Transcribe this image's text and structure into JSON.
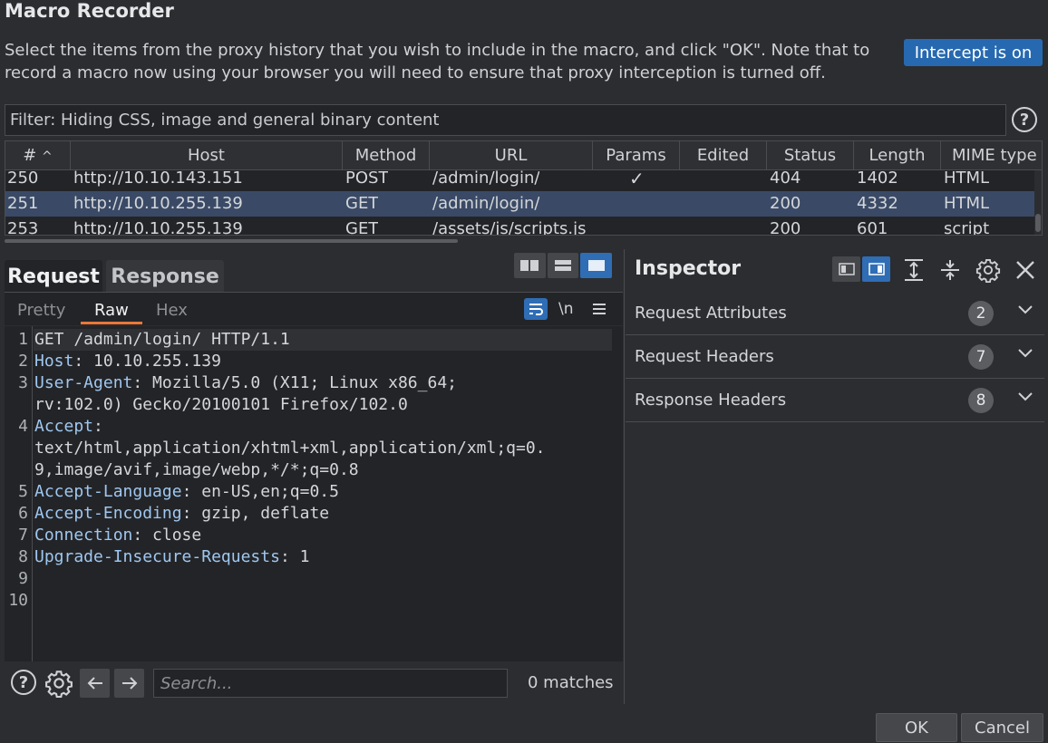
{
  "window": {
    "title": "Macro Recorder"
  },
  "description": "Select the items from the proxy history that you wish to include in the macro, and click \"OK\". Note that to record a macro now using your browser you will need to ensure that proxy interception is turned off.",
  "intercept_button": "Intercept is on",
  "filter": {
    "text": "Filter: Hiding CSS, image and general binary content"
  },
  "table": {
    "columns": [
      "#",
      "Host",
      "Method",
      "URL",
      "Params",
      "Edited",
      "Status",
      "Length",
      "MIME type"
    ],
    "sort_indicator": "^",
    "rows": [
      {
        "num": "250",
        "host": "http://10.10.143.151",
        "method": "POST",
        "url": "/admin/login/",
        "params": "✓",
        "edited": "",
        "status": "404",
        "length": "1402",
        "mime": "HTML"
      },
      {
        "num": "251",
        "host": "http://10.10.255.139",
        "method": "GET",
        "url": "/admin/login/",
        "params": "",
        "edited": "",
        "status": "200",
        "length": "4332",
        "mime": "HTML"
      },
      {
        "num": "253",
        "host": "http://10.10.255.139",
        "method": "GET",
        "url": "/assets/js/scripts.js",
        "params": "",
        "edited": "",
        "status": "200",
        "length": "601",
        "mime": "script"
      }
    ],
    "selected_row": "251"
  },
  "tabs": {
    "request": "Request",
    "response": "Response"
  },
  "subtabs": {
    "pretty": "Pretty",
    "raw": "Raw",
    "hex": "Hex",
    "newline": "\\n"
  },
  "editor": {
    "lines": [
      {
        "n": "1",
        "name": "",
        "value": "GET /admin/login/ HTTP/1.1"
      },
      {
        "n": "2",
        "name": "Host",
        "value": ": 10.10.255.139"
      },
      {
        "n": "3",
        "name": "User-Agent",
        "value": ": Mozilla/5.0 (X11; Linux x86_64;"
      },
      {
        "n": "",
        "name": "",
        "value": "rv:102.0) Gecko/20100101 Firefox/102.0"
      },
      {
        "n": "4",
        "name": "Accept",
        "value": ":"
      },
      {
        "n": "",
        "name": "",
        "value": "text/html,application/xhtml+xml,application/xml;q=0."
      },
      {
        "n": "",
        "name": "",
        "value": "9,image/avif,image/webp,*/*;q=0.8"
      },
      {
        "n": "5",
        "name": "Accept-Language",
        "value": ": en-US,en;q=0.5"
      },
      {
        "n": "6",
        "name": "Accept-Encoding",
        "value": ": gzip, deflate"
      },
      {
        "n": "7",
        "name": "Connection",
        "value": ": close"
      },
      {
        "n": "8",
        "name": "Upgrade-Insecure-Requests",
        "value": ": 1"
      },
      {
        "n": "9",
        "name": "",
        "value": ""
      },
      {
        "n": "10",
        "name": "",
        "value": ""
      }
    ]
  },
  "search": {
    "placeholder": "Search...",
    "matches": "0 matches"
  },
  "inspector": {
    "title": "Inspector",
    "sections": [
      {
        "label": "Request Attributes",
        "count": "2"
      },
      {
        "label": "Request Headers",
        "count": "7"
      },
      {
        "label": "Response Headers",
        "count": "8"
      }
    ]
  },
  "footer": {
    "ok": "OK",
    "cancel": "Cancel"
  },
  "colors": {
    "accent": "#2769b0",
    "tab_underline": "#e8783a",
    "selected_row": "#3a4a66"
  }
}
